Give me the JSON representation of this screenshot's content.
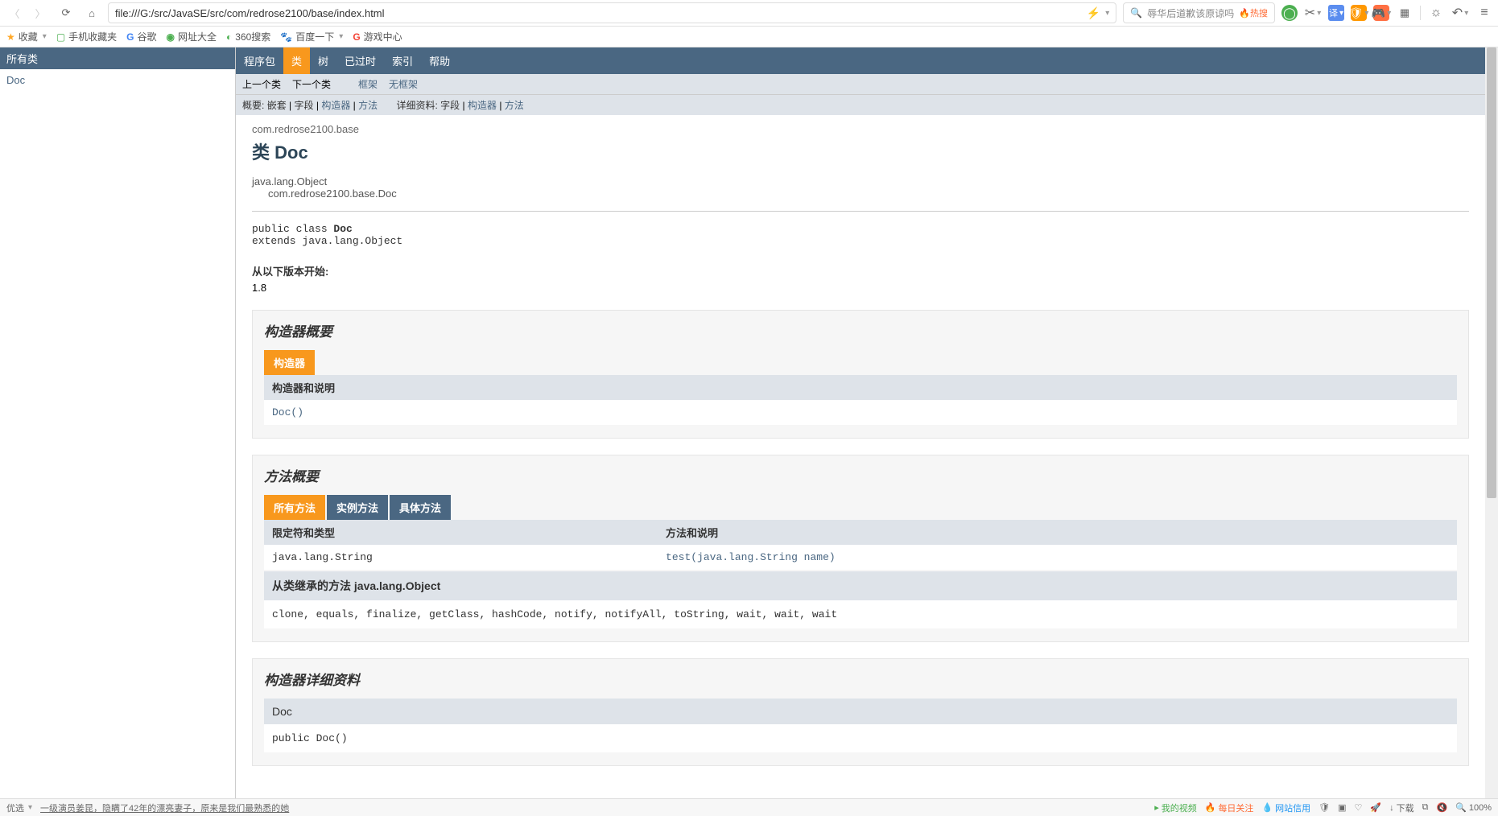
{
  "browser": {
    "url": "file:///G:/src/JavaSE/src/com/redrose2100/base/index.html",
    "search_placeholder": "辱华后道歉该原谅吗",
    "hot_label": "热搜"
  },
  "bookmarks": {
    "fav": "收藏",
    "mobile": "手机收藏夹",
    "google": "谷歌",
    "wangzhi": "网址大全",
    "s360": "360搜索",
    "baidu": "百度一下",
    "game": "游戏中心"
  },
  "sidebar": {
    "title": "所有类",
    "items": [
      "Doc"
    ]
  },
  "nav": {
    "items": [
      "程序包",
      "类",
      "树",
      "已过时",
      "索引",
      "帮助"
    ],
    "active_index": 1
  },
  "subnav": {
    "prev": "上一个类",
    "next": "下一个类",
    "frames": "框架",
    "noframes": "无框架"
  },
  "summary_row": {
    "summary_label": "概要:",
    "nested": "嵌套",
    "field": "字段",
    "constr": "构造器",
    "method": "方法",
    "detail_label": "详细资料:",
    "d_field": "字段",
    "d_constr": "构造器",
    "d_method": "方法"
  },
  "doc": {
    "package": "com.redrose2100.base",
    "class_prefix": "类 ",
    "class_name": "Doc",
    "inherit_root": "java.lang.Object",
    "inherit_self": "com.redrose2100.base.Doc",
    "sig_prefix": "public class ",
    "sig_name": "Doc",
    "sig_extends": "extends java.lang.Object",
    "since_label": "从以下版本开始:",
    "since_value": "1.8"
  },
  "constructor_summary": {
    "title": "构造器概要",
    "caption": "构造器",
    "col_header": "构造器和说明",
    "rows": [
      "Doc()"
    ]
  },
  "method_summary": {
    "title": "方法概要",
    "tabs": [
      "所有方法",
      "实例方法",
      "具体方法"
    ],
    "col1": "限定符和类型",
    "col2": "方法和说明",
    "rows": [
      {
        "type": "java.lang.String",
        "sig": "test(java.lang.String  name)"
      }
    ],
    "inherited_title": "从类继承的方法 java.lang.Object",
    "inherited_list": "clone, equals, finalize, getClass, hashCode, notify, notifyAll, toString, wait, wait, wait"
  },
  "constructor_detail": {
    "title": "构造器详细资料",
    "name": "Doc",
    "sig": "public  Doc()"
  },
  "statusbar": {
    "left1": "优选",
    "left2": "一级演员姜昆，隐瞒了42年的漂亮妻子，原来是我们最熟悉的她",
    "my_video": "我的视频",
    "daily": "每日关注",
    "credit": "网站信用",
    "download": "下载",
    "zoom": "100%"
  }
}
